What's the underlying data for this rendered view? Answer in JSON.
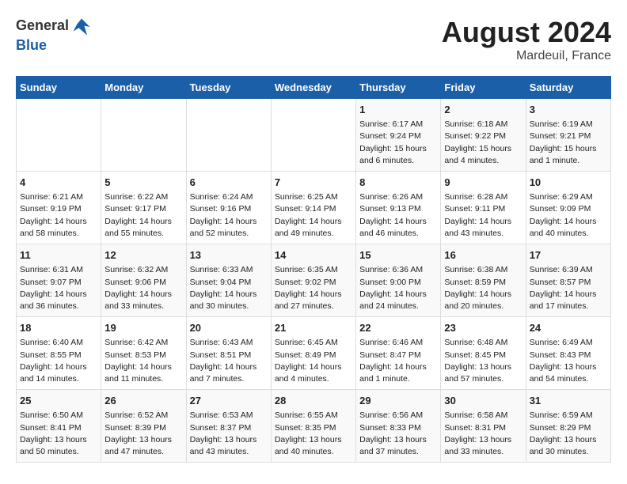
{
  "header": {
    "logo_general": "General",
    "logo_blue": "Blue",
    "month_year": "August 2024",
    "location": "Mardeuil, France"
  },
  "days_of_week": [
    "Sunday",
    "Monday",
    "Tuesday",
    "Wednesday",
    "Thursday",
    "Friday",
    "Saturday"
  ],
  "weeks": [
    [
      {
        "day": "",
        "content": ""
      },
      {
        "day": "",
        "content": ""
      },
      {
        "day": "",
        "content": ""
      },
      {
        "day": "",
        "content": ""
      },
      {
        "day": "1",
        "content": "Sunrise: 6:17 AM\nSunset: 9:24 PM\nDaylight: 15 hours\nand 6 minutes."
      },
      {
        "day": "2",
        "content": "Sunrise: 6:18 AM\nSunset: 9:22 PM\nDaylight: 15 hours\nand 4 minutes."
      },
      {
        "day": "3",
        "content": "Sunrise: 6:19 AM\nSunset: 9:21 PM\nDaylight: 15 hours\nand 1 minute."
      }
    ],
    [
      {
        "day": "4",
        "content": "Sunrise: 6:21 AM\nSunset: 9:19 PM\nDaylight: 14 hours\nand 58 minutes."
      },
      {
        "day": "5",
        "content": "Sunrise: 6:22 AM\nSunset: 9:17 PM\nDaylight: 14 hours\nand 55 minutes."
      },
      {
        "day": "6",
        "content": "Sunrise: 6:24 AM\nSunset: 9:16 PM\nDaylight: 14 hours\nand 52 minutes."
      },
      {
        "day": "7",
        "content": "Sunrise: 6:25 AM\nSunset: 9:14 PM\nDaylight: 14 hours\nand 49 minutes."
      },
      {
        "day": "8",
        "content": "Sunrise: 6:26 AM\nSunset: 9:13 PM\nDaylight: 14 hours\nand 46 minutes."
      },
      {
        "day": "9",
        "content": "Sunrise: 6:28 AM\nSunset: 9:11 PM\nDaylight: 14 hours\nand 43 minutes."
      },
      {
        "day": "10",
        "content": "Sunrise: 6:29 AM\nSunset: 9:09 PM\nDaylight: 14 hours\nand 40 minutes."
      }
    ],
    [
      {
        "day": "11",
        "content": "Sunrise: 6:31 AM\nSunset: 9:07 PM\nDaylight: 14 hours\nand 36 minutes."
      },
      {
        "day": "12",
        "content": "Sunrise: 6:32 AM\nSunset: 9:06 PM\nDaylight: 14 hours\nand 33 minutes."
      },
      {
        "day": "13",
        "content": "Sunrise: 6:33 AM\nSunset: 9:04 PM\nDaylight: 14 hours\nand 30 minutes."
      },
      {
        "day": "14",
        "content": "Sunrise: 6:35 AM\nSunset: 9:02 PM\nDaylight: 14 hours\nand 27 minutes."
      },
      {
        "day": "15",
        "content": "Sunrise: 6:36 AM\nSunset: 9:00 PM\nDaylight: 14 hours\nand 24 minutes."
      },
      {
        "day": "16",
        "content": "Sunrise: 6:38 AM\nSunset: 8:59 PM\nDaylight: 14 hours\nand 20 minutes."
      },
      {
        "day": "17",
        "content": "Sunrise: 6:39 AM\nSunset: 8:57 PM\nDaylight: 14 hours\nand 17 minutes."
      }
    ],
    [
      {
        "day": "18",
        "content": "Sunrise: 6:40 AM\nSunset: 8:55 PM\nDaylight: 14 hours\nand 14 minutes."
      },
      {
        "day": "19",
        "content": "Sunrise: 6:42 AM\nSunset: 8:53 PM\nDaylight: 14 hours\nand 11 minutes."
      },
      {
        "day": "20",
        "content": "Sunrise: 6:43 AM\nSunset: 8:51 PM\nDaylight: 14 hours\nand 7 minutes."
      },
      {
        "day": "21",
        "content": "Sunrise: 6:45 AM\nSunset: 8:49 PM\nDaylight: 14 hours\nand 4 minutes."
      },
      {
        "day": "22",
        "content": "Sunrise: 6:46 AM\nSunset: 8:47 PM\nDaylight: 14 hours\nand 1 minute."
      },
      {
        "day": "23",
        "content": "Sunrise: 6:48 AM\nSunset: 8:45 PM\nDaylight: 13 hours\nand 57 minutes."
      },
      {
        "day": "24",
        "content": "Sunrise: 6:49 AM\nSunset: 8:43 PM\nDaylight: 13 hours\nand 54 minutes."
      }
    ],
    [
      {
        "day": "25",
        "content": "Sunrise: 6:50 AM\nSunset: 8:41 PM\nDaylight: 13 hours\nand 50 minutes."
      },
      {
        "day": "26",
        "content": "Sunrise: 6:52 AM\nSunset: 8:39 PM\nDaylight: 13 hours\nand 47 minutes."
      },
      {
        "day": "27",
        "content": "Sunrise: 6:53 AM\nSunset: 8:37 PM\nDaylight: 13 hours\nand 43 minutes."
      },
      {
        "day": "28",
        "content": "Sunrise: 6:55 AM\nSunset: 8:35 PM\nDaylight: 13 hours\nand 40 minutes."
      },
      {
        "day": "29",
        "content": "Sunrise: 6:56 AM\nSunset: 8:33 PM\nDaylight: 13 hours\nand 37 minutes."
      },
      {
        "day": "30",
        "content": "Sunrise: 6:58 AM\nSunset: 8:31 PM\nDaylight: 13 hours\nand 33 minutes."
      },
      {
        "day": "31",
        "content": "Sunrise: 6:59 AM\nSunset: 8:29 PM\nDaylight: 13 hours\nand 30 minutes."
      }
    ]
  ]
}
